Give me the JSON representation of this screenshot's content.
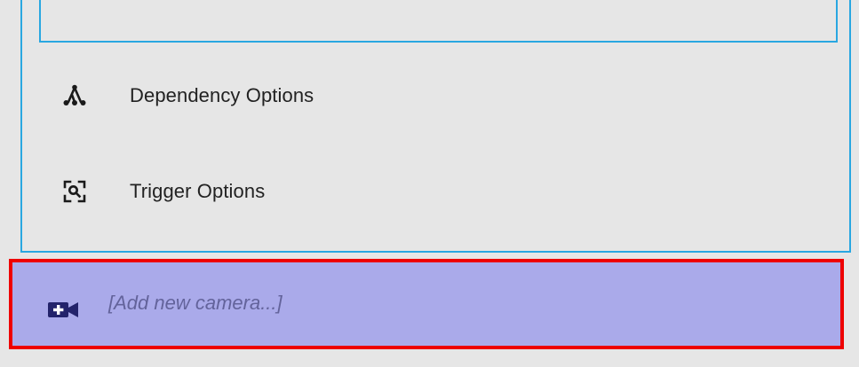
{
  "options": [
    {
      "label": "Dependency Options",
      "icon": "account-tree-icon"
    },
    {
      "label": "Trigger Options",
      "icon": "image-search-icon"
    }
  ],
  "add_camera": {
    "label": "[Add new camera...]",
    "icon": "add-video-camera-icon"
  },
  "colors": {
    "panel_border": "#29a7e1",
    "background": "#e6e6e6",
    "add_row_background": "#aaaaea",
    "highlight_border": "#ee0000",
    "add_label": "#63639b",
    "add_icon": "#23236b"
  }
}
